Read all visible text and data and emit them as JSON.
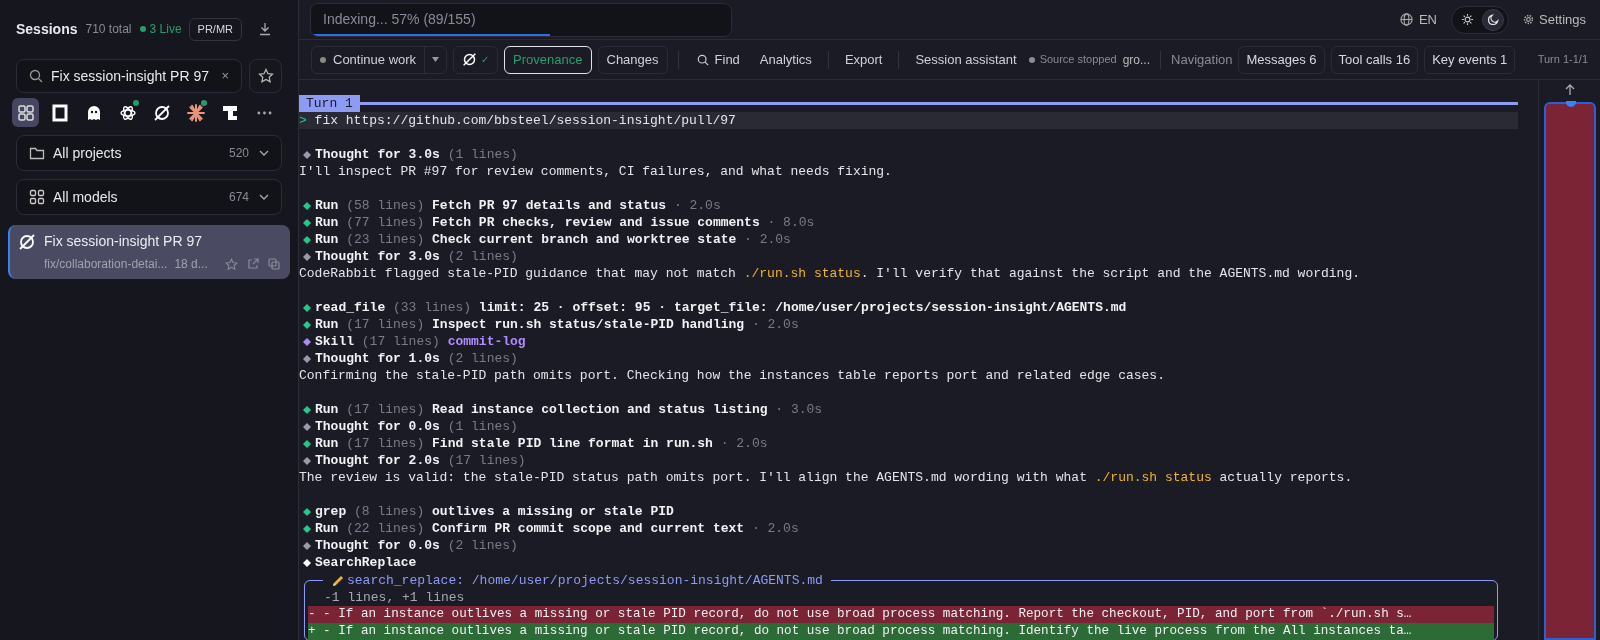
{
  "sidebar": {
    "title": "Sessions",
    "total": "710 total",
    "live": "3 Live",
    "pr_button": "PR/MR",
    "search": {
      "value": "Fix session-insight PR 97",
      "clear": "×"
    },
    "agents": [
      {
        "kind": "all",
        "selected": true,
        "live": false
      },
      {
        "kind": "square",
        "selected": false,
        "live": false
      },
      {
        "kind": "mascot",
        "selected": false,
        "live": false
      },
      {
        "kind": "knot",
        "selected": false,
        "live": true
      },
      {
        "kind": "slashed",
        "selected": false,
        "live": false
      },
      {
        "kind": "starburst",
        "selected": false,
        "live": true
      },
      {
        "kind": "tshape",
        "selected": false,
        "live": false
      }
    ],
    "dropdowns": [
      {
        "kind": "folder",
        "label": "All projects",
        "count": "520"
      },
      {
        "kind": "grid",
        "label": "All models",
        "count": "674"
      }
    ],
    "sessions": [
      {
        "title": "Fix session-insight PR 97",
        "branch": "fix/collaboration-detai...",
        "age": "18 d...",
        "selected": true
      }
    ]
  },
  "topbar": {
    "indexing": {
      "text": "Indexing... 57% (89/155)",
      "level": 0.57
    },
    "language": "EN",
    "theme_options": [
      {
        "kind": "light",
        "selected": false
      },
      {
        "kind": "dark",
        "selected": true
      }
    ],
    "settings": "Settings"
  },
  "toolbar": {
    "continue": "Continue work",
    "agent_check": "✓",
    "tabs": [
      {
        "label": "Provenance",
        "selected": true
      },
      {
        "label": "Changes",
        "selected": false
      }
    ],
    "actions": [
      {
        "kind": "find",
        "label": "Find"
      },
      {
        "kind": "plain",
        "label": "Analytics"
      },
      {
        "kind": "divider",
        "label": "Export"
      },
      {
        "kind": "divider",
        "label": "Session assistant"
      }
    ],
    "source_status": "Source stopped",
    "source": "gro...",
    "navigation": "Navigation",
    "nav_buttons": [
      "Messages 6",
      "Tool calls 16",
      "Key events 1"
    ],
    "turn": "Turn 1-1/1"
  },
  "transcript": {
    "turn": "Turn 1",
    "prompt_mark": ">",
    "prompt": "fix https://github.com/bbsteel/session-insight/pull/97",
    "blocks": [
      [
        {
          "kind": "thought",
          "label": "Thought for 3.0s",
          "count": "(1 lines)"
        },
        {
          "kind": "text",
          "parts": [
            {
              "text": "I'll inspect PR #97 for review comments, CI failures, and what needs fixing.",
              "code": false
            }
          ]
        }
      ],
      [
        {
          "kind": "tool",
          "name": "Run",
          "count": "(58 lines)",
          "detail": "Fetch PR 97 details and status",
          "duration": "· 2.0s"
        },
        {
          "kind": "tool",
          "name": "Run",
          "count": "(77 lines)",
          "detail": "Fetch PR checks, review and issue comments",
          "duration": "· 8.0s"
        },
        {
          "kind": "tool",
          "name": "Run",
          "count": "(23 lines)",
          "detail": "Check current branch and worktree state",
          "duration": "· 2.0s"
        },
        {
          "kind": "thought",
          "label": "Thought for 3.0s",
          "count": "(2 lines)"
        },
        {
          "kind": "text",
          "parts": [
            {
              "text": "CodeRabbit flagged stale-PID guidance that may not match ",
              "code": false
            },
            {
              "text": "./run.sh status",
              "code": true
            },
            {
              "text": ". I'll verify that against the script and the AGENTS.md wording.",
              "code": false
            }
          ]
        }
      ],
      [
        {
          "kind": "tool",
          "name": "read_file",
          "count": "(33 lines)",
          "detail": "limit: 25 · offset: 95 · target_file: /home/user/projects/session-insight/AGENTS.md"
        },
        {
          "kind": "tool",
          "name": "Run",
          "count": "(17 lines)",
          "detail": "Inspect run.sh status/stale-PID handling",
          "duration": "· 2.0s"
        },
        {
          "kind": "skill",
          "name": "Skill",
          "count": "(17 lines)",
          "detail": "commit-log"
        },
        {
          "kind": "thought",
          "label": "Thought for 1.0s",
          "count": "(2 lines)"
        },
        {
          "kind": "text",
          "parts": [
            {
              "text": "Confirming the stale-PID path omits port. Checking how the instances table reports port and related edge cases.",
              "code": false
            }
          ]
        }
      ],
      [
        {
          "kind": "tool",
          "name": "Run",
          "count": "(17 lines)",
          "detail": "Read instance collection and status listing",
          "duration": "· 3.0s"
        },
        {
          "kind": "thought",
          "label": "Thought for 0.0s",
          "count": "(1 lines)"
        },
        {
          "kind": "tool",
          "name": "Run",
          "count": "(17 lines)",
          "detail": "Find stale PID line format in run.sh",
          "duration": "· 2.0s"
        },
        {
          "kind": "thought",
          "label": "Thought for 2.0s",
          "count": "(17 lines)"
        },
        {
          "kind": "text",
          "parts": [
            {
              "text": "The review is valid: the stale-PID status path omits port. I'll align the AGENTS.md wording with what ",
              "code": false
            },
            {
              "text": "./run.sh status",
              "code": true
            },
            {
              "text": " actually reports.",
              "code": false
            }
          ]
        }
      ],
      [
        {
          "kind": "tool",
          "name": "grep",
          "count": "(8 lines)",
          "detail": "outlives a missing or stale PID"
        },
        {
          "kind": "tool",
          "name": "Run",
          "count": "(22 lines)",
          "detail": "Confirm PR commit scope and current text",
          "duration": "· 2.0s"
        },
        {
          "kind": "thought",
          "label": "Thought for 0.0s",
          "count": "(2 lines)"
        },
        {
          "kind": "edit",
          "name": "SearchReplace"
        },
        {
          "kind": "diff",
          "title": "search_replace: /home/user/projects/session-insight/AGENTS.md",
          "summary": "-1 lines, +1 lines",
          "lines": [
            {
              "kind": "removed",
              "text": "- - If an instance outlives a missing or stale PID record, do not use broad process matching. Report the checkout, PID, and port from `./run.sh s…"
            },
            {
              "kind": "added",
              "text": "+ - If an instance outlives a missing or stale PID record, do not use broad process matching. Identify the live process from the All instances ta…"
            }
          ]
        }
      ]
    ]
  }
}
